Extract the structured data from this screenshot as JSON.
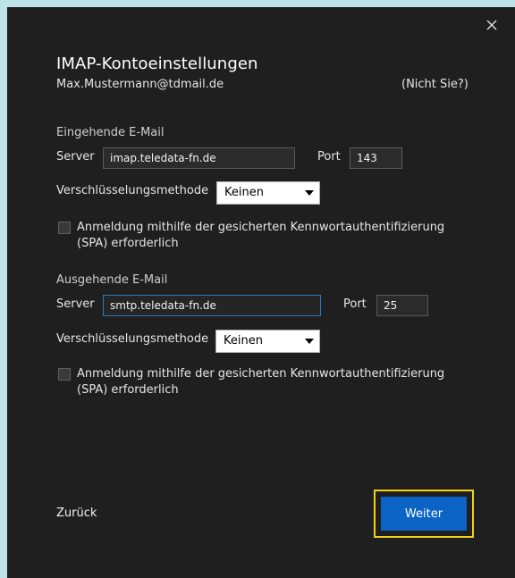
{
  "dialog": {
    "title": "IMAP-Kontoeinstellungen",
    "email": "Max.Mustermann@tdmail.de",
    "not_you": "(Nicht Sie?)"
  },
  "incoming": {
    "section_label": "Eingehende E-Mail",
    "server_label": "Server",
    "server_value": "imap.teledata-fn.de",
    "port_label": "Port",
    "port_value": "143",
    "encryption_label": "Verschlüsselungsmethode",
    "encryption_selected": "Keinen",
    "spa_label_line1": "Anmeldung mithilfe der gesicherten Kennwortauthentifizierung",
    "spa_label_line2": "(SPA) erforderlich"
  },
  "outgoing": {
    "section_label": "Ausgehende E-Mail",
    "server_label": "Server",
    "server_value": "smtp.teledata-fn.de",
    "port_label": "Port",
    "port_value": "25",
    "encryption_label": "Verschlüsselungsmethode",
    "encryption_selected": "Keinen",
    "spa_label_line1": "Anmeldung mithilfe der gesicherten Kennwortauthentifizierung",
    "spa_label_line2": "(SPA) erforderlich"
  },
  "footer": {
    "back_label": "Zurück",
    "next_label": "Weiter"
  },
  "colors": {
    "background": "#1f1f1f",
    "accent": "#0a63c5",
    "focus_ring": "#f2d21b",
    "input_focus": "#2a79c4"
  },
  "icons": {
    "close": "close-icon",
    "dropdown": "chevron-down-icon"
  }
}
